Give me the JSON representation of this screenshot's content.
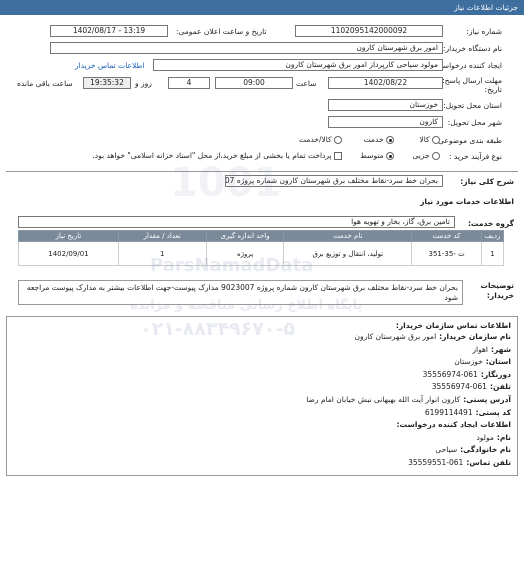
{
  "header": {
    "title": "جزئیات اطلاعات نیاز"
  },
  "form": {
    "need_number_label": "شماره نیاز:",
    "need_number": "1102095142000092",
    "announce_label": "تاریخ و ساعت اعلان عمومی:",
    "announce_value": "1402/08/17 - 13:19",
    "buyer_org_label": "نام دستگاه خریدار:",
    "buyer_org": "امور برق شهرستان کارون",
    "creator_label": "ایجاد کننده درخواست:",
    "creator": "مولود سیاحی کارپرداز امور برق شهرستان کارون",
    "buyer_contact_link": "اطلاعات تماس خریدار",
    "deadline_label": "مهلت ارسال پاسخ: تا تاریخ:",
    "deadline_date": "1402/08/22",
    "time_label": "ساعت",
    "deadline_time": "09:00",
    "days_value": "4",
    "days_label": "روز و",
    "remaining_time": "19:35:32",
    "remaining_label": "ساعت باقی مانده",
    "province_label": "استان محل تحویل:",
    "province": "خوزستان",
    "city_label": "شهر محل تحویل:",
    "city": "کارون",
    "category_label": "طبقه بندی موضوعی:",
    "category_options": [
      "کالا",
      "خدمت",
      "کالا/خدمت"
    ],
    "category_selected": "خدمت",
    "purchase_label": "نوع فرآیند خرید :",
    "purchase_options": [
      "جزیی",
      "متوسط"
    ],
    "purchase_selected": "متوسط",
    "payment_note": "پرداخت تمام یا بخشی از مبلغ خرید،از محل \"اسناد خزانه اسلامی\" خواهد بود."
  },
  "summary": {
    "label": "شرح کلی نیاز:",
    "text": "بحران خط سرد-نقاط مختلف برق شهرستان کارون شماره پروژه 9023007"
  },
  "services": {
    "section_title": "اطلاعات خدمات مورد نیاز",
    "group_label": "گروه خدمت:",
    "group_value": "تامین برق، گاز، بخار و تهویه هوا",
    "columns": [
      "ردیف",
      "کد خدمت",
      "نام خدمت",
      "واحد اندازه گیری",
      "تعداد / مقدار",
      "تاریخ نیاز"
    ],
    "rows": [
      {
        "index": "1",
        "code": "ت -35-351",
        "name": "تولید، انتقال و توزیع برق",
        "unit": "پروژه",
        "qty": "1",
        "date": "1402/09/01"
      }
    ]
  },
  "buyer_notes": {
    "label": "توضیحات خریدار:",
    "text": "بحران خط سرد-نقاط مختلف برق شهرستان کارون شماره پروژه 9023007 مدارک پیوست-جهت اطلاعات بیشتر به مدارک پیوست مراجعه شود"
  },
  "contact": {
    "title": "اطلاعات تماس سازمان خریدار:",
    "lines": [
      {
        "label": "نام سازمان خریدار:",
        "value": "امور برق شهرستان کارون"
      },
      {
        "label": "شهر:",
        "value": "اهواز"
      },
      {
        "label": "استان:",
        "value": "خوزستان"
      },
      {
        "label": "دورنگار:",
        "value": "061-35556974"
      },
      {
        "label": "تلفن:",
        "value": "061-35556974"
      },
      {
        "label": "آدرس پستی:",
        "value": "کارون انوار آیت الله بهبهانی نبش خیابان امام رضا"
      },
      {
        "label": "کد پستی:",
        "value": "6199114491"
      },
      {
        "label": "اطلاعات ایجاد کننده درخواست:",
        "value": ""
      },
      {
        "label": "نام:",
        "value": "مولود"
      },
      {
        "label": "نام خانوادگی:",
        "value": "سیاحی"
      },
      {
        "label": "تلفن تماس:",
        "value": "061-35559551"
      }
    ]
  },
  "watermark": {
    "brand": "ParsNamadData",
    "line1": "پایگاه اطلاع رسانی مناقصه و مزایده",
    "phone": "۰۲۱-۸۸۳۴۹۶۷۰-۵"
  }
}
